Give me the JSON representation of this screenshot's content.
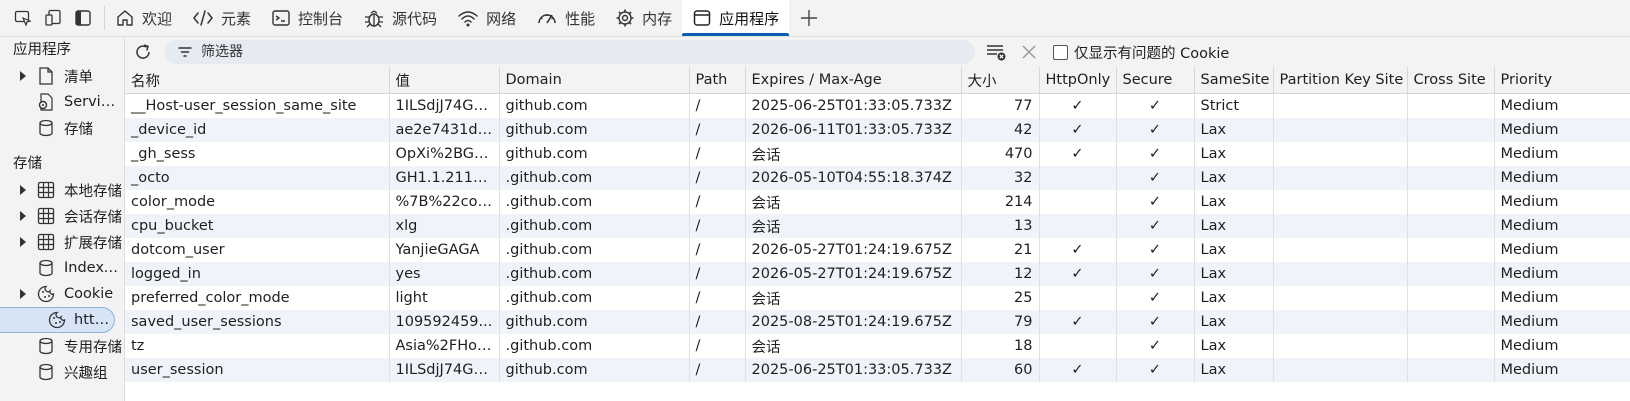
{
  "tabs": [
    {
      "label": "欢迎",
      "icon": "home-icon"
    },
    {
      "label": "元素",
      "icon": "code-icon"
    },
    {
      "label": "控制台",
      "icon": "console-icon"
    },
    {
      "label": "源代码",
      "icon": "bug-icon"
    },
    {
      "label": "网络",
      "icon": "wifi-icon"
    },
    {
      "label": "性能",
      "icon": "gauge-icon"
    },
    {
      "label": "内存",
      "icon": "cog-icon"
    },
    {
      "label": "应用程序",
      "icon": "app-window-icon",
      "active": true
    }
  ],
  "sidebar": {
    "app_section": "应用程序",
    "app_items": [
      {
        "label": "清单",
        "icon": "file-icon",
        "expandable": true
      },
      {
        "label": "Service Workers",
        "icon": "gear-doc-icon",
        "expandable": false
      },
      {
        "label": "存储",
        "icon": "database-icon",
        "expandable": false
      }
    ],
    "storage_section": "存储",
    "storage_items": [
      {
        "label": "本地存储",
        "icon": "table-icon",
        "expandable": true
      },
      {
        "label": "会话存储",
        "icon": "table-icon",
        "expandable": true
      },
      {
        "label": "扩展存储",
        "icon": "table-icon",
        "expandable": true
      },
      {
        "label": "IndexedDB",
        "icon": "database-icon",
        "expandable": false
      },
      {
        "label": "Cookie",
        "icon": "cookie-icon",
        "expandable": true
      }
    ],
    "cookie_child": "https://github.com",
    "after_items": [
      {
        "label": "专用存储",
        "icon": "database-icon"
      },
      {
        "label": "兴趣组",
        "icon": "database-icon"
      }
    ]
  },
  "filterbar": {
    "placeholder": "筛选器",
    "checkbox_label": "仅显示有问题的 Cookie"
  },
  "table": {
    "columns": [
      "名称",
      "值",
      "Domain",
      "Path",
      "Expires / Max-Age",
      "大小",
      "HttpOnly",
      "Secure",
      "SameSite",
      "Partition Key Site",
      "Cross Site",
      "Priority"
    ],
    "rows": [
      [
        "__Host-user_session_same_site",
        "1ILSdjJ74Gy...",
        "github.com",
        "/",
        "2025-06-25T01:33:05.733Z",
        "77",
        "✓",
        "✓",
        "Strict",
        "",
        "",
        "Medium"
      ],
      [
        "_device_id",
        "ae2e7431d2...",
        "github.com",
        "/",
        "2026-06-11T01:33:05.733Z",
        "42",
        "✓",
        "✓",
        "Lax",
        "",
        "",
        "Medium"
      ],
      [
        "_gh_sess",
        "OpXi%2BGF...",
        "github.com",
        "/",
        "会话",
        "470",
        "✓",
        "✓",
        "Lax",
        "",
        "",
        "Medium"
      ],
      [
        "_octo",
        "GH1.1.2117...",
        ".github.com",
        "/",
        "2026-05-10T04:55:18.374Z",
        "32",
        "",
        "✓",
        "Lax",
        "",
        "",
        "Medium"
      ],
      [
        "color_mode",
        "%7B%22col...",
        ".github.com",
        "/",
        "会话",
        "214",
        "",
        "✓",
        "Lax",
        "",
        "",
        "Medium"
      ],
      [
        "cpu_bucket",
        "xlg",
        ".github.com",
        "/",
        "会话",
        "13",
        "",
        "✓",
        "Lax",
        "",
        "",
        "Medium"
      ],
      [
        "dotcom_user",
        "YanjieGAGA",
        ".github.com",
        "/",
        "2026-05-27T01:24:19.675Z",
        "21",
        "✓",
        "✓",
        "Lax",
        "",
        "",
        "Medium"
      ],
      [
        "logged_in",
        "yes",
        ".github.com",
        "/",
        "2026-05-27T01:24:19.675Z",
        "12",
        "✓",
        "✓",
        "Lax",
        "",
        "",
        "Medium"
      ],
      [
        "preferred_color_mode",
        "light",
        ".github.com",
        "/",
        "会话",
        "25",
        "",
        "✓",
        "Lax",
        "",
        "",
        "Medium"
      ],
      [
        "saved_user_sessions",
        "109592459...",
        "github.com",
        "/",
        "2025-08-25T01:24:19.675Z",
        "79",
        "✓",
        "✓",
        "Lax",
        "",
        "",
        "Medium"
      ],
      [
        "tz",
        "Asia%2FHon...",
        ".github.com",
        "/",
        "会话",
        "18",
        "",
        "✓",
        "Lax",
        "",
        "",
        "Medium"
      ],
      [
        "user_session",
        "1ILSdjJ74Gy...",
        "github.com",
        "/",
        "2025-06-25T01:33:05.733Z",
        "60",
        "✓",
        "✓",
        "Lax",
        "",
        "",
        "Medium"
      ]
    ]
  },
  "colors": {
    "accent": "#0a5fb4",
    "selected_bg": "#d6e4f5",
    "stripe": "#f0f4fa"
  }
}
